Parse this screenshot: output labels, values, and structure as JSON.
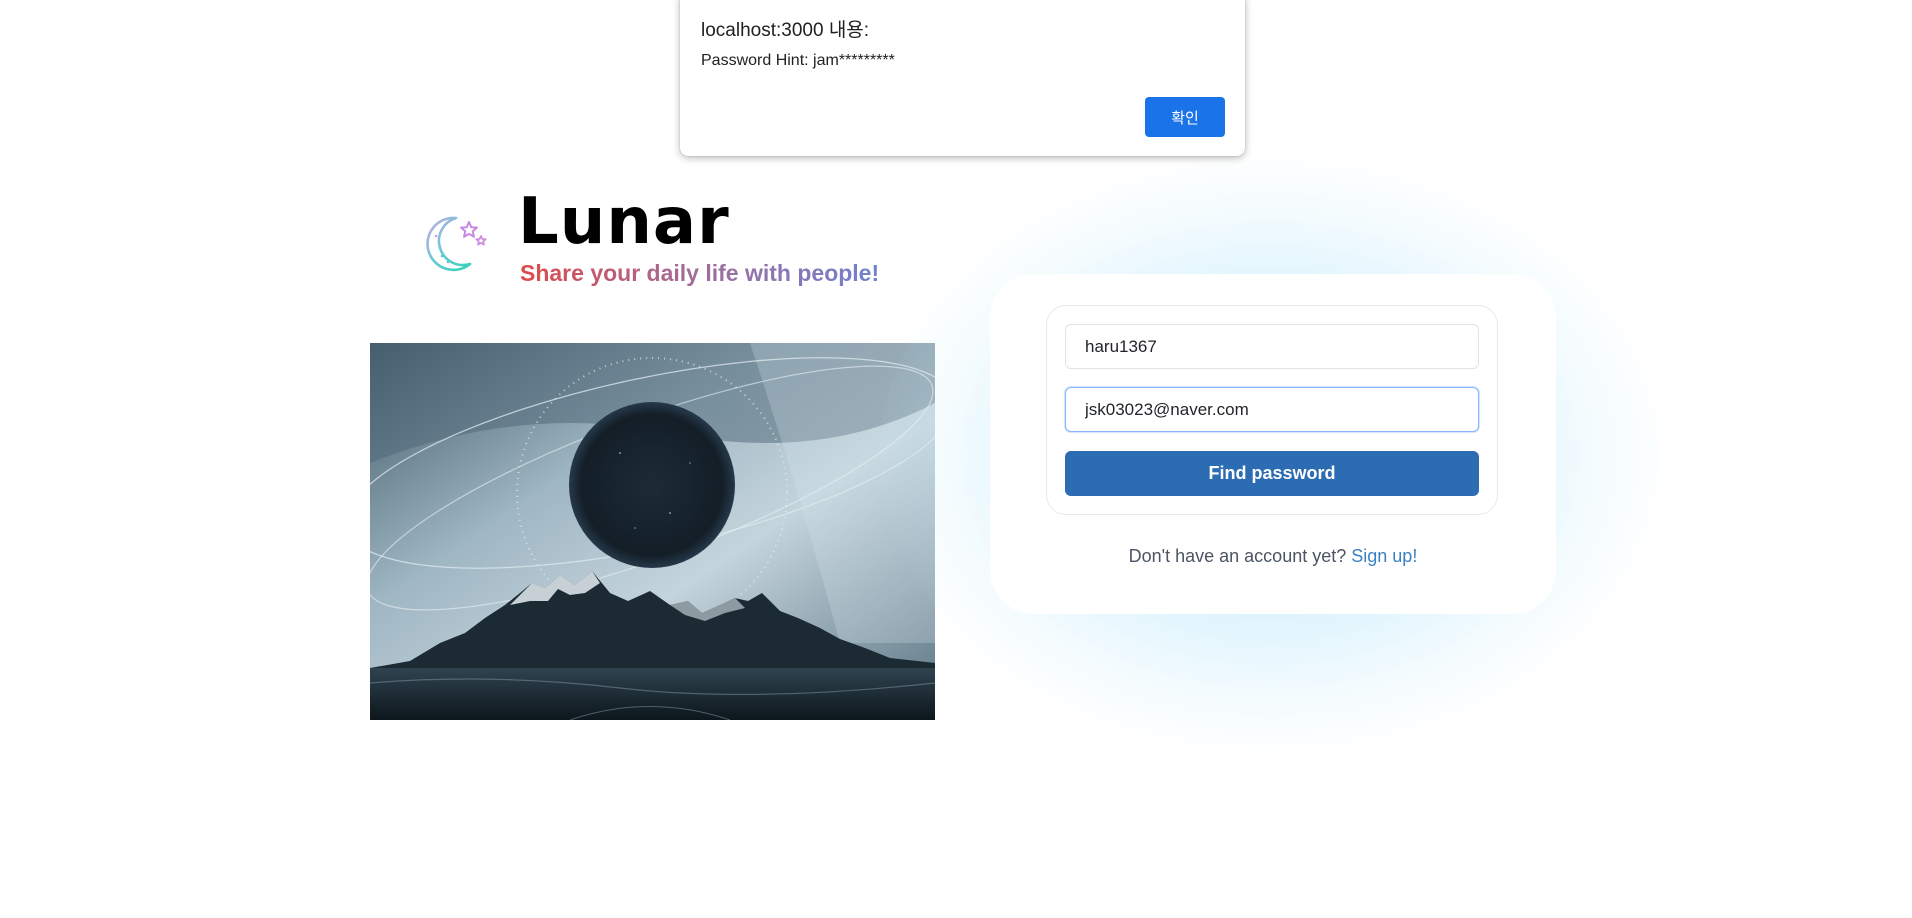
{
  "alert": {
    "title": "localhost:3000 내용:",
    "message": "Password Hint: jam*********",
    "ok_label": "확인"
  },
  "brand": {
    "name": "Lunar",
    "tagline": "Share your daily life with people!",
    "logo_icon": "moon-stars-icon"
  },
  "hero": {
    "image": "eclipse-mountains-image"
  },
  "form": {
    "username_value": "haru1367",
    "email_value": "jsk03023@naver.com",
    "submit_label": "Find password"
  },
  "signup": {
    "prompt": "Don't have an account yet?",
    "link_label": "Sign up!"
  },
  "colors": {
    "primary_button": "#2b6cb3",
    "alert_button": "#1a73e8",
    "link": "#3b82c4",
    "glow": "#8fd9f5",
    "tagline_start": "#de4a4a",
    "tagline_end": "#6f82d0"
  }
}
